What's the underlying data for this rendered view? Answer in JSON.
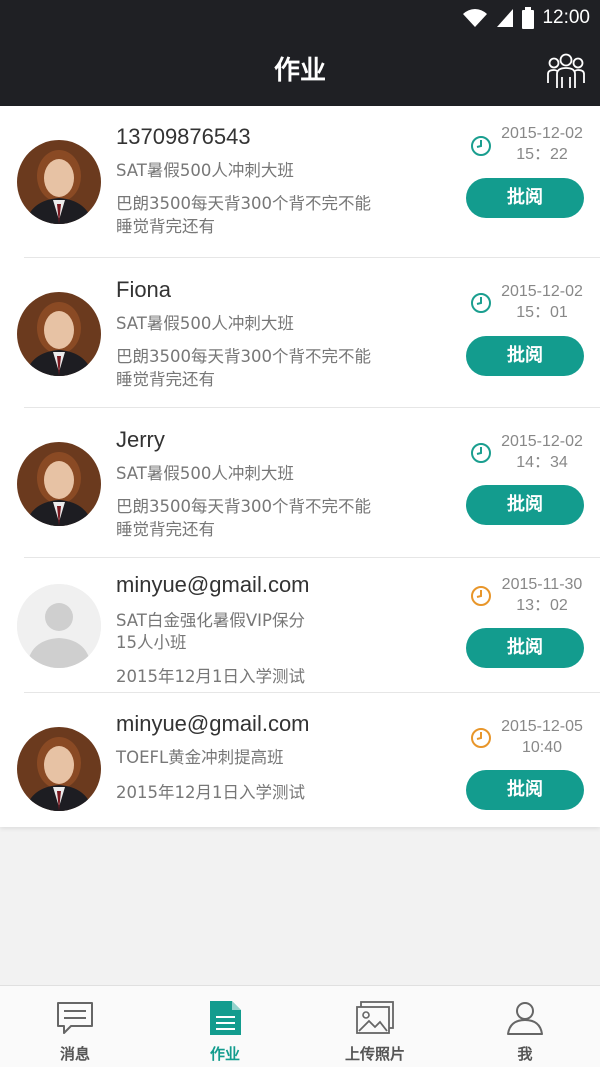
{
  "status_bar": {
    "time": "12:00"
  },
  "header": {
    "title": "作业",
    "right_icon": "group-icon"
  },
  "homework": [
    {
      "name": "13709876543",
      "course": "SAT暑假500人冲刺大班",
      "desc": [
        "巴朗3500每天背300个背不完不能",
        "睡觉背完还有"
      ],
      "date": "2015-12-02",
      "time": "15：22",
      "clock_color": "#1a9e8f",
      "avatar": "photo",
      "action": "批阅"
    },
    {
      "name": "Fiona",
      "course": "SAT暑假500人冲刺大班",
      "desc": [
        "巴朗3500每天背300个背不完不能",
        "睡觉背完还有"
      ],
      "date": "2015-12-02",
      "time": "15：01",
      "clock_color": "#1a9e8f",
      "avatar": "photo",
      "action": "批阅"
    },
    {
      "name": "Jerry",
      "course": "SAT暑假500人冲刺大班",
      "desc": [
        "巴朗3500每天背300个背不完不能",
        "睡觉背完还有"
      ],
      "date": "2015-12-02",
      "time": "14：34",
      "clock_color": "#1a9e8f",
      "avatar": "photo",
      "action": "批阅"
    },
    {
      "name": "minyue@gmail.com",
      "course": "SAT白金强化暑假VIP保分",
      "course_line2": "15人小班",
      "desc": [
        "2015年12月1日入学测试"
      ],
      "date": "2015-11-30",
      "time": "13：02",
      "clock_color": "#e8962a",
      "avatar": "placeholder",
      "action": "批阅"
    },
    {
      "name": "minyue@gmail.com",
      "course": "TOEFL黄金冲刺提高班",
      "desc": [
        "2015年12月1日入学测试"
      ],
      "date": "2015-12-05",
      "time": "10:40",
      "clock_color": "#e8962a",
      "avatar": "photo",
      "action": "批阅"
    }
  ],
  "tabs": [
    {
      "label": "消息",
      "icon": "message-icon",
      "active": false
    },
    {
      "label": "作业",
      "icon": "homework-document-icon",
      "active": true
    },
    {
      "label": "上传照片",
      "icon": "photo-upload-icon",
      "active": false
    },
    {
      "label": "我",
      "icon": "profile-icon",
      "active": false
    }
  ],
  "colors": {
    "accent": "#139c8e",
    "header_bg": "#1f2024",
    "recent_clock": "#1a9e8f",
    "older_clock": "#e8962a"
  }
}
